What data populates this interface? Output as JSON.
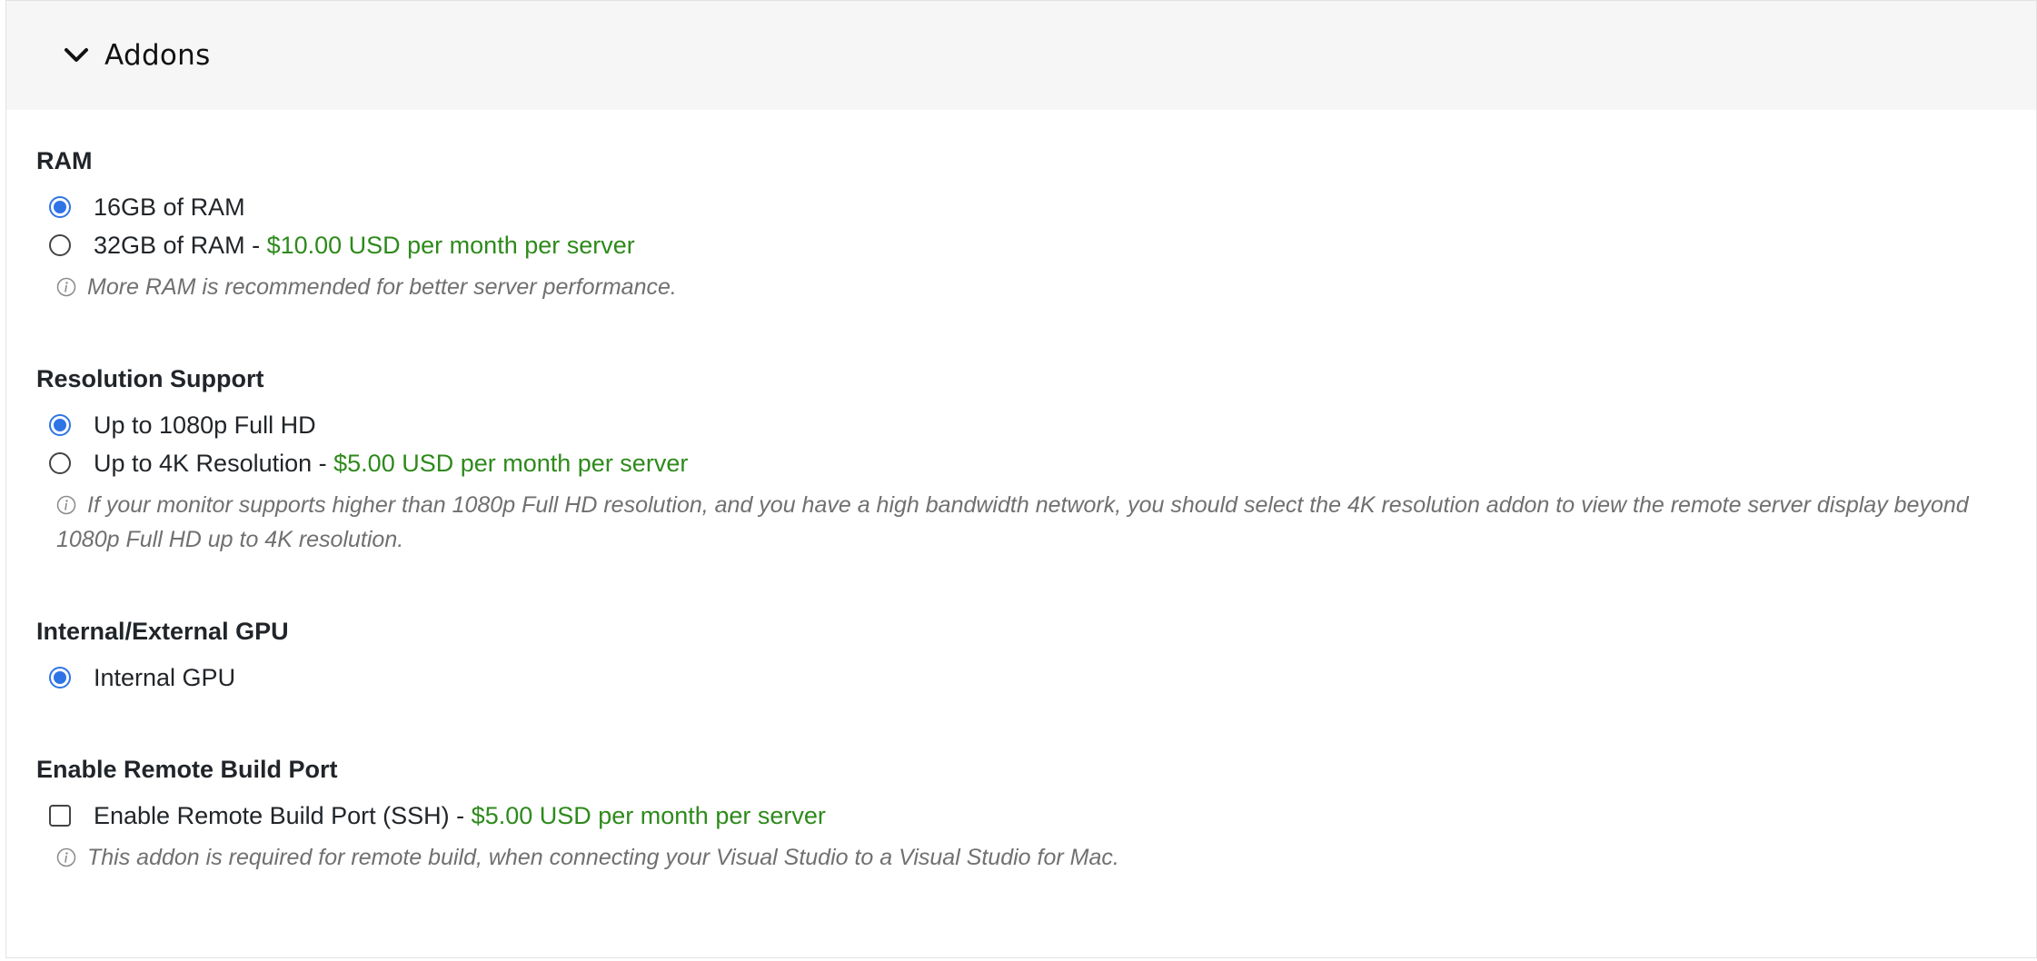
{
  "header": {
    "title": "Addons",
    "toggle_icon": "chevron-down-icon"
  },
  "colors": {
    "accent": "#2f74e6",
    "price": "#2e8a1c",
    "hint": "#707070",
    "header_bg": "#f6f6f6"
  },
  "ram": {
    "title": "RAM",
    "options": [
      {
        "label": "16GB of RAM",
        "price": "",
        "selected": true
      },
      {
        "label": "32GB of RAM",
        "separator": " - ",
        "price": "$10.00 USD per month per server",
        "selected": false
      }
    ],
    "hint": "More RAM is recommended for better server performance."
  },
  "resolution": {
    "title": "Resolution Support",
    "options": [
      {
        "label": "Up to 1080p Full HD",
        "price": "",
        "selected": true
      },
      {
        "label": "Up to 4K Resolution",
        "separator": " - ",
        "price": "$5.00 USD per month per server",
        "selected": false
      }
    ],
    "hint": "If your monitor supports higher than 1080p Full HD resolution, and you have a high bandwidth network, you should select the 4K resolution addon to view the remote server display beyond 1080p Full HD up to 4K resolution."
  },
  "gpu": {
    "title": "Internal/External GPU",
    "options": [
      {
        "label": "Internal GPU",
        "selected": true
      }
    ]
  },
  "remote_build": {
    "title": "Enable Remote Build Port",
    "option": {
      "label": "Enable Remote Build Port (SSH)",
      "separator": " - ",
      "price": "$5.00 USD per month per server",
      "checked": false
    },
    "hint": "This addon is required for remote build, when connecting your Visual Studio to a Visual Studio for Mac."
  }
}
